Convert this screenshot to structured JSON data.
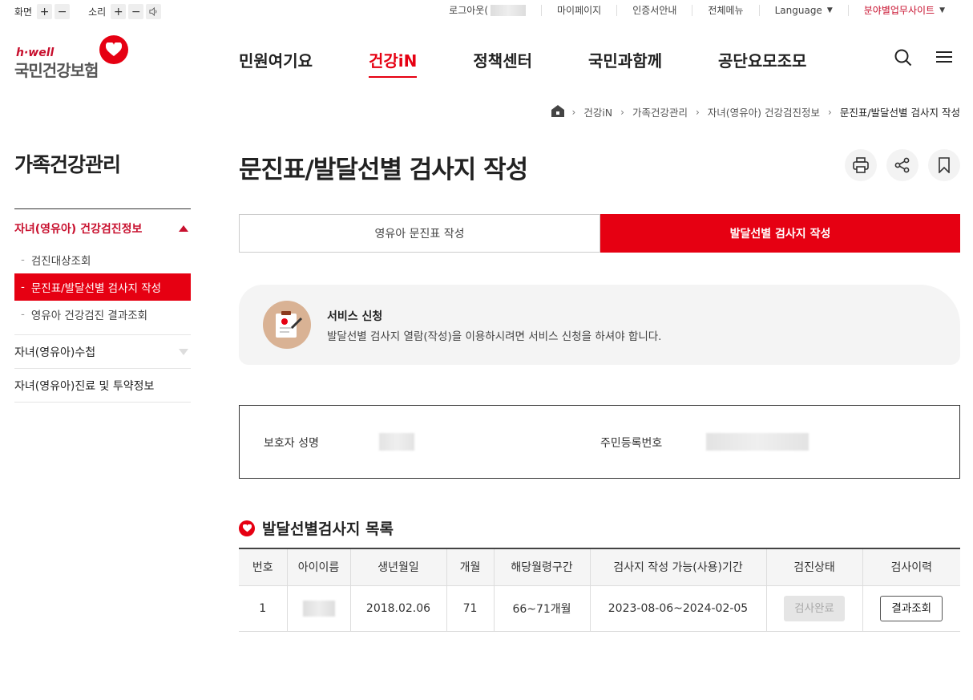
{
  "util": {
    "screen_label": "화면",
    "sound_label": "소리",
    "plus": "+",
    "minus": "−",
    "links": {
      "logout": "로그아웃(",
      "mypage": "마이페이지",
      "cert": "인증서안내",
      "allmenu": "전체메뉴",
      "language": "Language",
      "biz": "분야별업무사이트"
    }
  },
  "logo": {
    "brand_small": "h·well",
    "brand_name": "국민건강보험"
  },
  "gnb": [
    "민원여기요",
    "건강iN",
    "정책센터",
    "국민과함께",
    "공단요모조모"
  ],
  "breadcrumb": [
    "건강iN",
    "가족건강관리",
    "자녀(영유아) 건강검진정보",
    "문진표/발달선별 검사지 작성"
  ],
  "lnb": {
    "title": "가족건강관리",
    "d1_active": "자녀(영유아) 건강검진정보",
    "d2": [
      "검진대상조회",
      "문진표/발달선별 검사지 작성",
      "영유아 건강검진 결과조회"
    ],
    "d1_others": [
      "자녀(영유아)수첩",
      "자녀(영유아)진료 및 투약정보"
    ]
  },
  "page": {
    "title": "문진표/발달선별 검사지 작성"
  },
  "tabs": [
    "영유아 문진표 작성",
    "발달선별 검사지 작성"
  ],
  "notice": {
    "title": "서비스 신청",
    "desc": "발달선별 검사지 열람(작성)을 이용하시려면 서비스 신청을 하셔야 합니다."
  },
  "info": {
    "guardian_label": "보호자 성명",
    "rrn_label": "주민등록번호"
  },
  "list": {
    "title": "발달선별검사지 목록",
    "headers": [
      "번호",
      "아이이름",
      "생년월일",
      "개월",
      "해당월령구간",
      "검사지 작성 가능(사용)기간",
      "검진상태",
      "검사이력"
    ],
    "rows": [
      {
        "no": "1",
        "birth": "2018.02.06",
        "months": "71",
        "range": "66~71개월",
        "period": "2023-08-06~2024-02-05",
        "status": "검사완료",
        "history": "결과조회"
      }
    ]
  },
  "colors": {
    "accent": "#e60012",
    "accent_text": "#c8102e"
  }
}
